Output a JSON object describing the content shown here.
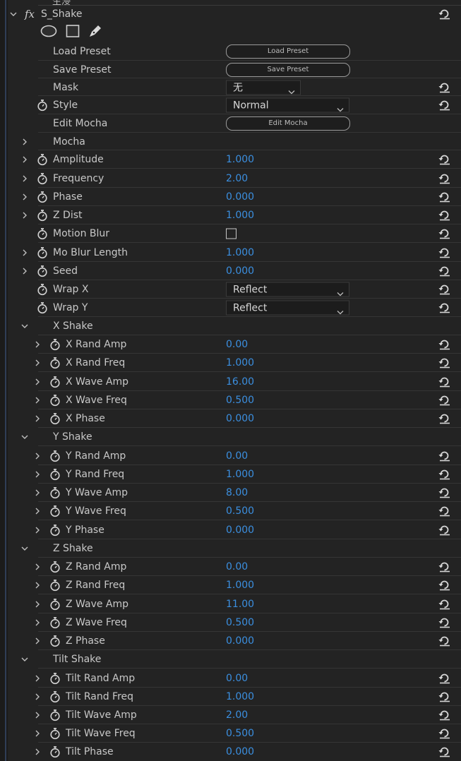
{
  "top_cut_label": "生浸",
  "effect": {
    "fx_label": "fx",
    "name": "S_Shake",
    "tools": [
      "ellipse-mask-tool-icon",
      "rectangle-mask-tool-icon",
      "pen-mask-tool-icon"
    ]
  },
  "load_preset": {
    "label": "Load Preset",
    "button": "Load Preset"
  },
  "save_preset": {
    "label": "Save Preset",
    "button": "Save Preset"
  },
  "mask": {
    "label": "Mask",
    "value": "无"
  },
  "style": {
    "label": "Style",
    "value": "Normal"
  },
  "edit_mocha": {
    "label": "Edit Mocha",
    "button": "Edit Mocha"
  },
  "mocha": {
    "label": "Mocha"
  },
  "amplitude": {
    "label": "Amplitude",
    "value": "1.000"
  },
  "frequency": {
    "label": "Frequency",
    "value": "2.00"
  },
  "phase": {
    "label": "Phase",
    "value": "0.000"
  },
  "z_dist": {
    "label": "Z Dist",
    "value": "1.000"
  },
  "motion_blur": {
    "label": "Motion Blur",
    "checked": false
  },
  "mo_blur_length": {
    "label": "Mo Blur Length",
    "value": "1.000"
  },
  "seed": {
    "label": "Seed",
    "value": "0.000"
  },
  "wrap_x": {
    "label": "Wrap X",
    "value": "Reflect"
  },
  "wrap_y": {
    "label": "Wrap Y",
    "value": "Reflect"
  },
  "x_shake": {
    "label": "X Shake",
    "rand_amp": {
      "label": "X Rand Amp",
      "value": "0.00"
    },
    "rand_freq": {
      "label": "X Rand Freq",
      "value": "1.000"
    },
    "wave_amp": {
      "label": "X Wave Amp",
      "value": "16.00"
    },
    "wave_freq": {
      "label": "X Wave Freq",
      "value": "0.500"
    },
    "phase": {
      "label": "X Phase",
      "value": "0.000"
    }
  },
  "y_shake": {
    "label": "Y Shake",
    "rand_amp": {
      "label": "Y Rand Amp",
      "value": "0.00"
    },
    "rand_freq": {
      "label": "Y Rand Freq",
      "value": "1.000"
    },
    "wave_amp": {
      "label": "Y Wave Amp",
      "value": "8.00"
    },
    "wave_freq": {
      "label": "Y Wave Freq",
      "value": "0.500"
    },
    "phase": {
      "label": "Y Phase",
      "value": "0.000"
    }
  },
  "z_shake": {
    "label": "Z Shake",
    "rand_amp": {
      "label": "Z Rand Amp",
      "value": "0.00"
    },
    "rand_freq": {
      "label": "Z Rand Freq",
      "value": "1.000"
    },
    "wave_amp": {
      "label": "Z Wave Amp",
      "value": "11.00"
    },
    "wave_freq": {
      "label": "Z Wave Freq",
      "value": "0.500"
    },
    "phase": {
      "label": "Z Phase",
      "value": "0.000"
    }
  },
  "tilt_shake": {
    "label": "Tilt Shake",
    "rand_amp": {
      "label": "Tilt Rand Amp",
      "value": "0.00"
    },
    "rand_freq": {
      "label": "Tilt Rand Freq",
      "value": "1.000"
    },
    "wave_amp": {
      "label": "Tilt Wave Amp",
      "value": "2.00"
    },
    "wave_freq": {
      "label": "Tilt Wave Freq",
      "value": "0.500"
    },
    "phase": {
      "label": "Tilt Phase",
      "value": "0.000"
    }
  },
  "colors": {
    "value_blue": "#3b8fe0",
    "panel_bg": "#232323",
    "text": "#c8c8c8"
  }
}
